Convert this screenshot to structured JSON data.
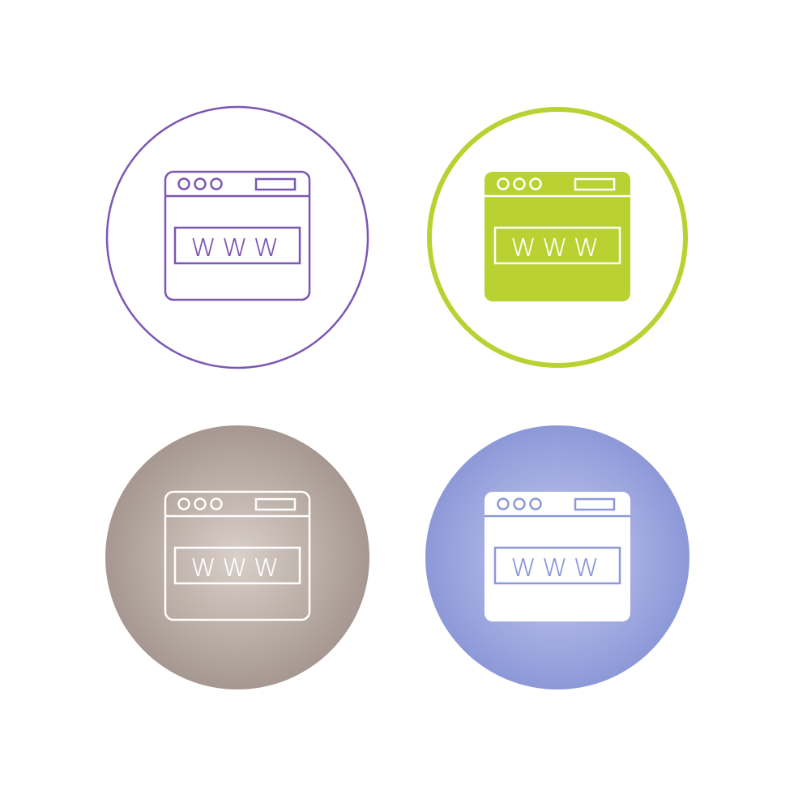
{
  "icon_set": {
    "icons": [
      {
        "name": "browser-www-outline-icon",
        "style": "outline",
        "label": "www",
        "colors": {
          "ring": "#7b57b4",
          "stroke": "#7b57b4",
          "fill": "#ffffff"
        }
      },
      {
        "name": "browser-www-filled-icon",
        "style": "filled",
        "label": "www",
        "colors": {
          "ring": "#b9d232",
          "stroke": "#ffffff",
          "fill": "#b9d232"
        }
      },
      {
        "name": "browser-www-outline-on-circle-icon",
        "style": "outline-on-circle",
        "label": "www",
        "colors": {
          "circle_center": "#d6ccc4",
          "circle_edge": "#a69890",
          "stroke": "#ffffff"
        }
      },
      {
        "name": "browser-www-filled-on-circle-icon",
        "style": "filled-on-circle",
        "label": "www",
        "colors": {
          "circle_center": "#c3caef",
          "circle_edge": "#8d98d8",
          "stroke": "#8d98d8",
          "fill": "#ffffff"
        }
      }
    ]
  }
}
